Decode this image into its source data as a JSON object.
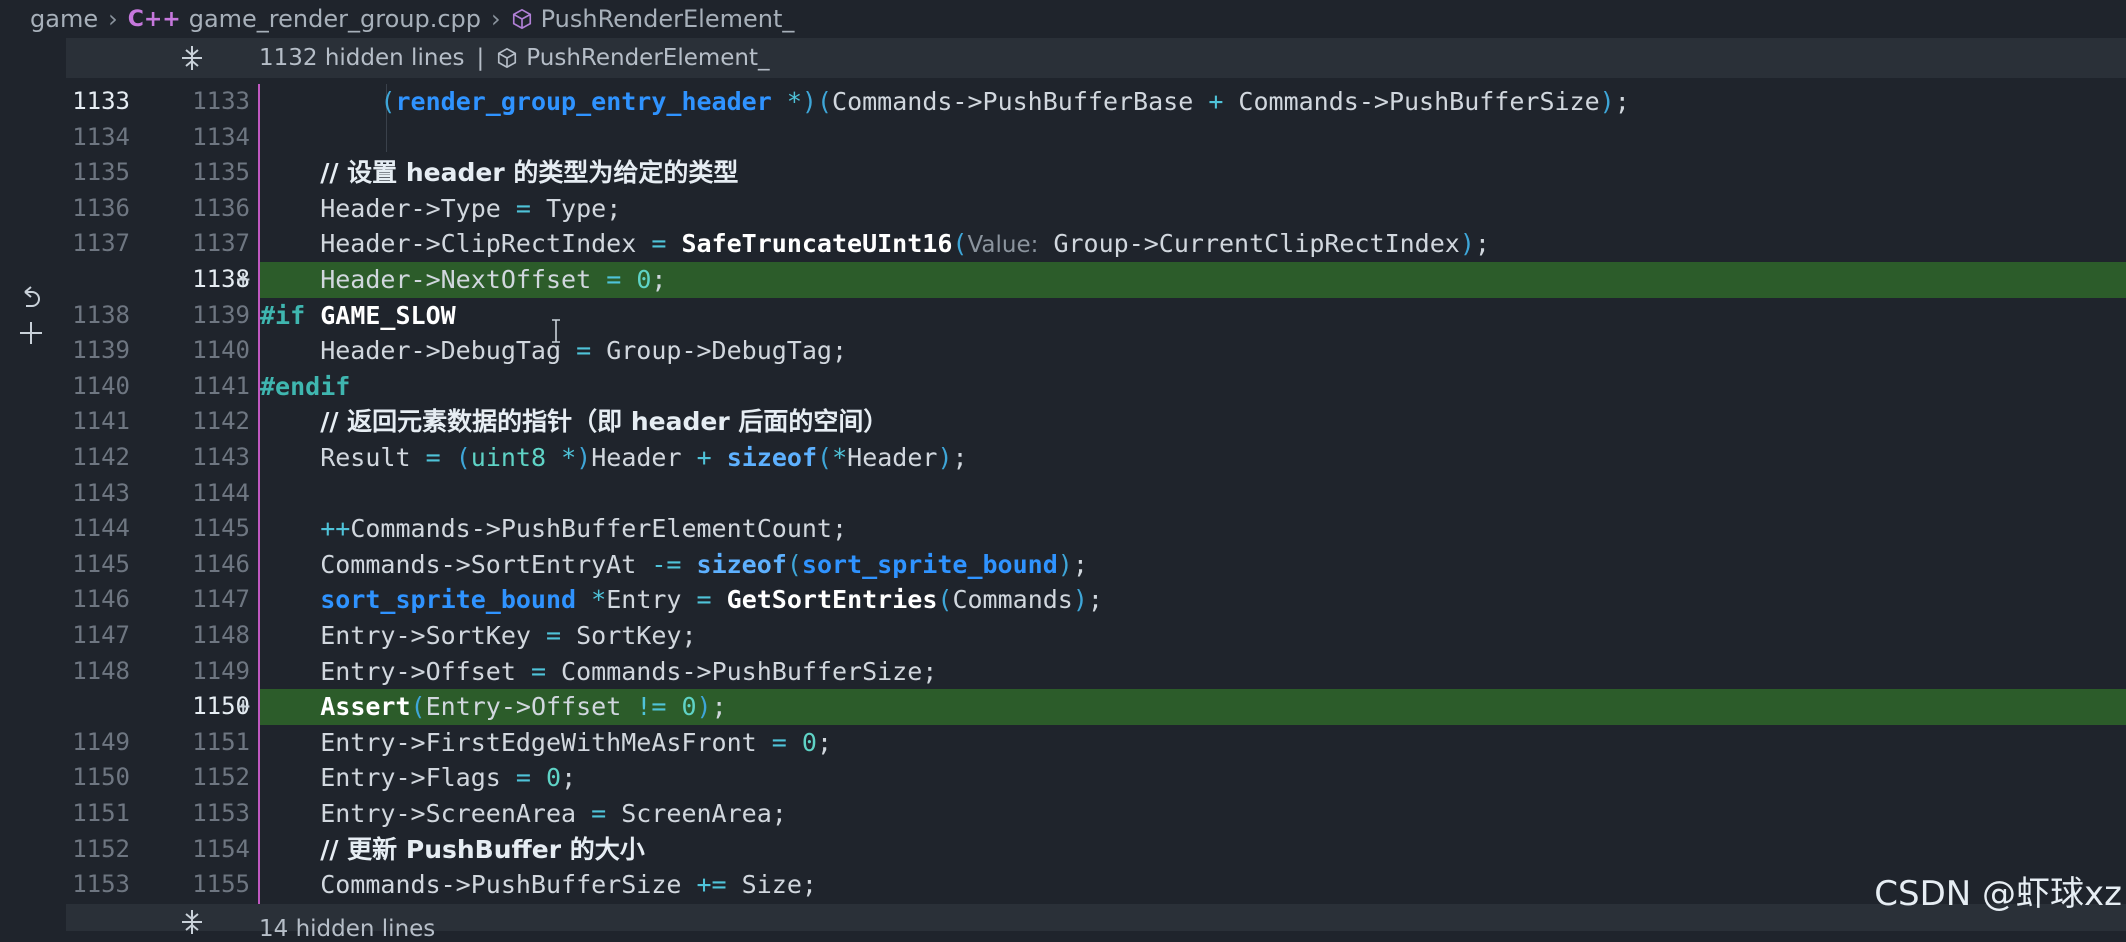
{
  "breadcrumb": {
    "root": "game",
    "lang_badge": "C++",
    "file": "game_render_group.cpp",
    "symbol": "PushRenderElement_"
  },
  "banner_top": {
    "text": "1132 hidden lines",
    "symbol": "PushRenderElement_"
  },
  "banner_bottom": {
    "text": "14 hidden lines"
  },
  "watermark": "CSDN @虾球xz",
  "colors": {
    "added_bg": "#2c5c2a",
    "gutter_marker": "#c058c0",
    "background": "#1f242c"
  },
  "lines": [
    {
      "old": "1133",
      "new": "1133",
      "added": false,
      "current": true,
      "tokens": [
        [
          "plain",
          "        "
        ],
        [
          "paren",
          "("
        ],
        [
          "type",
          "render_group_entry_header"
        ],
        [
          "plain",
          " "
        ],
        [
          "op",
          "*"
        ],
        [
          "paren",
          ")("
        ],
        [
          "plain",
          "Commands->PushBufferBase "
        ],
        [
          "op",
          "+"
        ],
        [
          "plain",
          " Commands->PushBufferSize"
        ],
        [
          "paren",
          ")"
        ],
        [
          "plain",
          ";"
        ]
      ]
    },
    {
      "old": "1134",
      "new": "1134",
      "added": false,
      "tokens": [
        [
          "plain",
          ""
        ]
      ]
    },
    {
      "old": "1135",
      "new": "1135",
      "added": false,
      "tokens": [
        [
          "plain",
          "    "
        ],
        [
          "comment",
          "// 设置 header 的类型为给定的类型"
        ]
      ]
    },
    {
      "old": "1136",
      "new": "1136",
      "added": false,
      "tokens": [
        [
          "plain",
          "    Header->Type "
        ],
        [
          "op",
          "="
        ],
        [
          "plain",
          " Type;"
        ]
      ]
    },
    {
      "old": "1137",
      "new": "1137",
      "added": false,
      "tokens": [
        [
          "plain",
          "    Header->ClipRectIndex "
        ],
        [
          "op",
          "="
        ],
        [
          "plain",
          " "
        ],
        [
          "fn",
          "SafeTruncateUInt16"
        ],
        [
          "paren",
          "("
        ],
        [
          "hint",
          "Value:"
        ],
        [
          "plain",
          " Group->CurrentClipRectIndex"
        ],
        [
          "paren",
          ")"
        ],
        [
          "plain",
          ";"
        ]
      ]
    },
    {
      "old": "",
      "new": "1138",
      "added": true,
      "tokens": [
        [
          "plain",
          "    Header->NextOffset "
        ],
        [
          "op",
          "="
        ],
        [
          "plain",
          " "
        ],
        [
          "num",
          "0"
        ],
        [
          "plain",
          ";"
        ]
      ]
    },
    {
      "old": "1138",
      "new": "1139",
      "added": false,
      "tokens": [
        [
          "pp",
          "#if"
        ],
        [
          "plain",
          " "
        ],
        [
          "fn",
          "GAME_SLOW"
        ]
      ]
    },
    {
      "old": "1139",
      "new": "1140",
      "added": false,
      "tokens": [
        [
          "plain",
          "    Header->DebugTag "
        ],
        [
          "op",
          "="
        ],
        [
          "plain",
          " Group->DebugTag;"
        ]
      ]
    },
    {
      "old": "1140",
      "new": "1141",
      "added": false,
      "tokens": [
        [
          "pp",
          "#endif"
        ]
      ]
    },
    {
      "old": "1141",
      "new": "1142",
      "added": false,
      "tokens": [
        [
          "plain",
          "    "
        ],
        [
          "comment",
          "// 返回元素数据的指针（即 header 后面的空间）"
        ]
      ]
    },
    {
      "old": "1142",
      "new": "1143",
      "added": false,
      "tokens": [
        [
          "plain",
          "    Result "
        ],
        [
          "op",
          "="
        ],
        [
          "plain",
          " "
        ],
        [
          "paren",
          "("
        ],
        [
          "num",
          "uint8"
        ],
        [
          "plain",
          " "
        ],
        [
          "op",
          "*"
        ],
        [
          "paren",
          ")"
        ],
        [
          "plain",
          "Header "
        ],
        [
          "op",
          "+"
        ],
        [
          "plain",
          " "
        ],
        [
          "kw",
          "sizeof"
        ],
        [
          "paren",
          "("
        ],
        [
          "op",
          "*"
        ],
        [
          "plain",
          "Header"
        ],
        [
          "paren",
          ")"
        ],
        [
          "plain",
          ";"
        ]
      ]
    },
    {
      "old": "1143",
      "new": "1144",
      "added": false,
      "tokens": [
        [
          "plain",
          ""
        ]
      ]
    },
    {
      "old": "1144",
      "new": "1145",
      "added": false,
      "tokens": [
        [
          "plain",
          "    "
        ],
        [
          "op",
          "++"
        ],
        [
          "plain",
          "Commands->PushBufferElementCount;"
        ]
      ]
    },
    {
      "old": "1145",
      "new": "1146",
      "added": false,
      "tokens": [
        [
          "plain",
          "    Commands->SortEntryAt "
        ],
        [
          "op",
          "-="
        ],
        [
          "plain",
          " "
        ],
        [
          "kw",
          "sizeof"
        ],
        [
          "paren",
          "("
        ],
        [
          "type",
          "sort_sprite_bound"
        ],
        [
          "paren",
          ")"
        ],
        [
          "plain",
          ";"
        ]
      ]
    },
    {
      "old": "1146",
      "new": "1147",
      "added": false,
      "tokens": [
        [
          "plain",
          "    "
        ],
        [
          "type",
          "sort_sprite_bound"
        ],
        [
          "plain",
          " "
        ],
        [
          "op",
          "*"
        ],
        [
          "plain",
          "Entry "
        ],
        [
          "op",
          "="
        ],
        [
          "plain",
          " "
        ],
        [
          "fn",
          "GetSortEntries"
        ],
        [
          "paren",
          "("
        ],
        [
          "plain",
          "Commands"
        ],
        [
          "paren",
          ")"
        ],
        [
          "plain",
          ";"
        ]
      ]
    },
    {
      "old": "1147",
      "new": "1148",
      "added": false,
      "tokens": [
        [
          "plain",
          "    Entry->SortKey "
        ],
        [
          "op",
          "="
        ],
        [
          "plain",
          " SortKey;"
        ]
      ]
    },
    {
      "old": "1148",
      "new": "1149",
      "added": false,
      "tokens": [
        [
          "plain",
          "    Entry->Offset "
        ],
        [
          "op",
          "="
        ],
        [
          "plain",
          " Commands->PushBufferSize;"
        ]
      ]
    },
    {
      "old": "",
      "new": "1150",
      "added": true,
      "tokens": [
        [
          "plain",
          "    "
        ],
        [
          "fn",
          "Assert"
        ],
        [
          "paren",
          "("
        ],
        [
          "plain",
          "Entry->Offset "
        ],
        [
          "op",
          "!="
        ],
        [
          "plain",
          " "
        ],
        [
          "num",
          "0"
        ],
        [
          "paren",
          ")"
        ],
        [
          "plain",
          ";"
        ]
      ]
    },
    {
      "old": "1149",
      "new": "1151",
      "added": false,
      "tokens": [
        [
          "plain",
          "    Entry->FirstEdgeWithMeAsFront "
        ],
        [
          "op",
          "="
        ],
        [
          "plain",
          " "
        ],
        [
          "num",
          "0"
        ],
        [
          "plain",
          ";"
        ]
      ]
    },
    {
      "old": "1150",
      "new": "1152",
      "added": false,
      "tokens": [
        [
          "plain",
          "    Entry->Flags "
        ],
        [
          "op",
          "="
        ],
        [
          "plain",
          " "
        ],
        [
          "num",
          "0"
        ],
        [
          "plain",
          ";"
        ]
      ]
    },
    {
      "old": "1151",
      "new": "1153",
      "added": false,
      "tokens": [
        [
          "plain",
          "    Entry->ScreenArea "
        ],
        [
          "op",
          "="
        ],
        [
          "plain",
          " ScreenArea;"
        ]
      ]
    },
    {
      "old": "1152",
      "new": "1154",
      "added": false,
      "tokens": [
        [
          "plain",
          "    "
        ],
        [
          "comment",
          "// 更新 PushBuffer 的大小"
        ]
      ]
    },
    {
      "old": "1153",
      "new": "1155",
      "added": false,
      "tokens": [
        [
          "plain",
          "    Commands->PushBufferSize "
        ],
        [
          "op",
          "+="
        ],
        [
          "plain",
          " Size;"
        ]
      ]
    }
  ]
}
